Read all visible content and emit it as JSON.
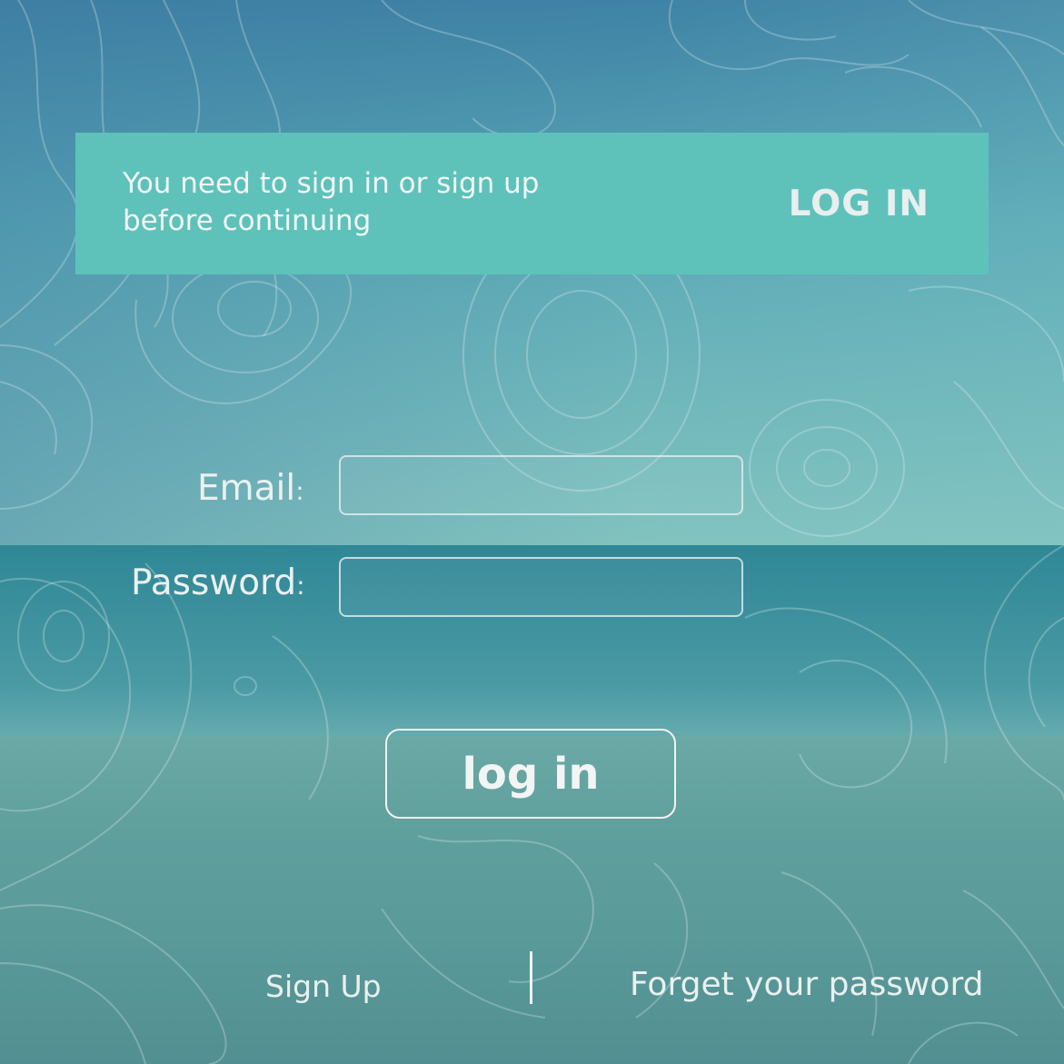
{
  "banner": {
    "message_line1": "You need to sign in or sign up",
    "message_line2": "before continuing",
    "login_label": "LOG IN",
    "background_color": "#5ec2bb"
  },
  "form": {
    "email_label": "Email",
    "password_label": "Password",
    "colon": ":",
    "email_value": "",
    "password_value": "",
    "submit_label": "log in"
  },
  "footer": {
    "signup_label": "Sign Up",
    "forgot_label": "Forget your password"
  }
}
